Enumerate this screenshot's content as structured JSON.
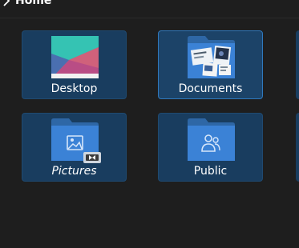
{
  "header": {
    "title": "Home"
  },
  "folders": [
    {
      "label": "Desktop",
      "italic": false,
      "selected": false,
      "icon": "desktop-wallpaper-thumbnail"
    },
    {
      "label": "Documents",
      "italic": false,
      "selected": true,
      "icon": "documents-folder-thumbnail"
    },
    {
      "label": "Pictures",
      "italic": true,
      "selected": false,
      "icon": "pictures-folder-icon"
    },
    {
      "label": "Public",
      "italic": false,
      "selected": false,
      "icon": "public-folder-icon"
    }
  ],
  "colors": {
    "background": "#1e1e1e",
    "tile": "#193d5f",
    "selected_border": "#2f79bd",
    "folder_blue": "#3b82d6"
  }
}
